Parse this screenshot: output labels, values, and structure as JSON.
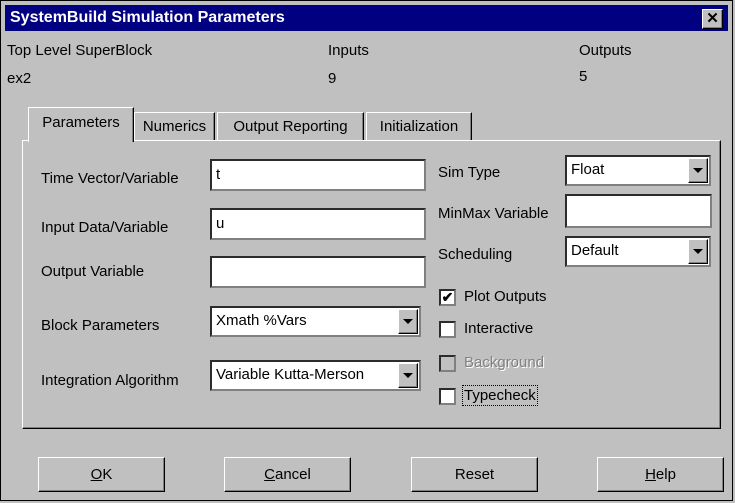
{
  "window": {
    "title": "SystemBuild Simulation Parameters",
    "close_glyph": "✕"
  },
  "info": {
    "superblock_label": "Top Level SuperBlock",
    "superblock_value": "ex2",
    "inputs_label": "Inputs",
    "inputs_value": "9",
    "outputs_label": "Outputs",
    "outputs_value": "5"
  },
  "tabs": [
    {
      "label": "Parameters",
      "active": true
    },
    {
      "label": "Numerics",
      "active": false
    },
    {
      "label": "Output Reporting",
      "active": false
    },
    {
      "label": "Initialization",
      "active": false
    }
  ],
  "params": {
    "time_vector_label": "Time Vector/Variable",
    "time_vector_value": "t",
    "input_data_label": "Input Data/Variable",
    "input_data_value": "u",
    "output_var_label": "Output Variable",
    "output_var_value": "",
    "block_params_label": "Block Parameters",
    "block_params_value": "Xmath %Vars",
    "integration_label": "Integration Algorithm",
    "integration_value": "Variable Kutta-Merson",
    "sim_type_label": "Sim Type",
    "sim_type_value": "Float",
    "minmax_label": "MinMax Variable",
    "minmax_value": "",
    "scheduling_label": "Scheduling",
    "scheduling_value": "Default"
  },
  "checkboxes": {
    "plot_outputs": {
      "label": "Plot Outputs",
      "checked": true,
      "mark": "✔"
    },
    "interactive": {
      "label": "Interactive",
      "checked": false
    },
    "background": {
      "label": "Background",
      "checked": false,
      "disabled": true
    },
    "typecheck": {
      "label": "Typecheck",
      "checked": false
    }
  },
  "buttons": {
    "ok": "OK",
    "cancel": "Cancel",
    "reset": "Reset",
    "help": "Help"
  }
}
